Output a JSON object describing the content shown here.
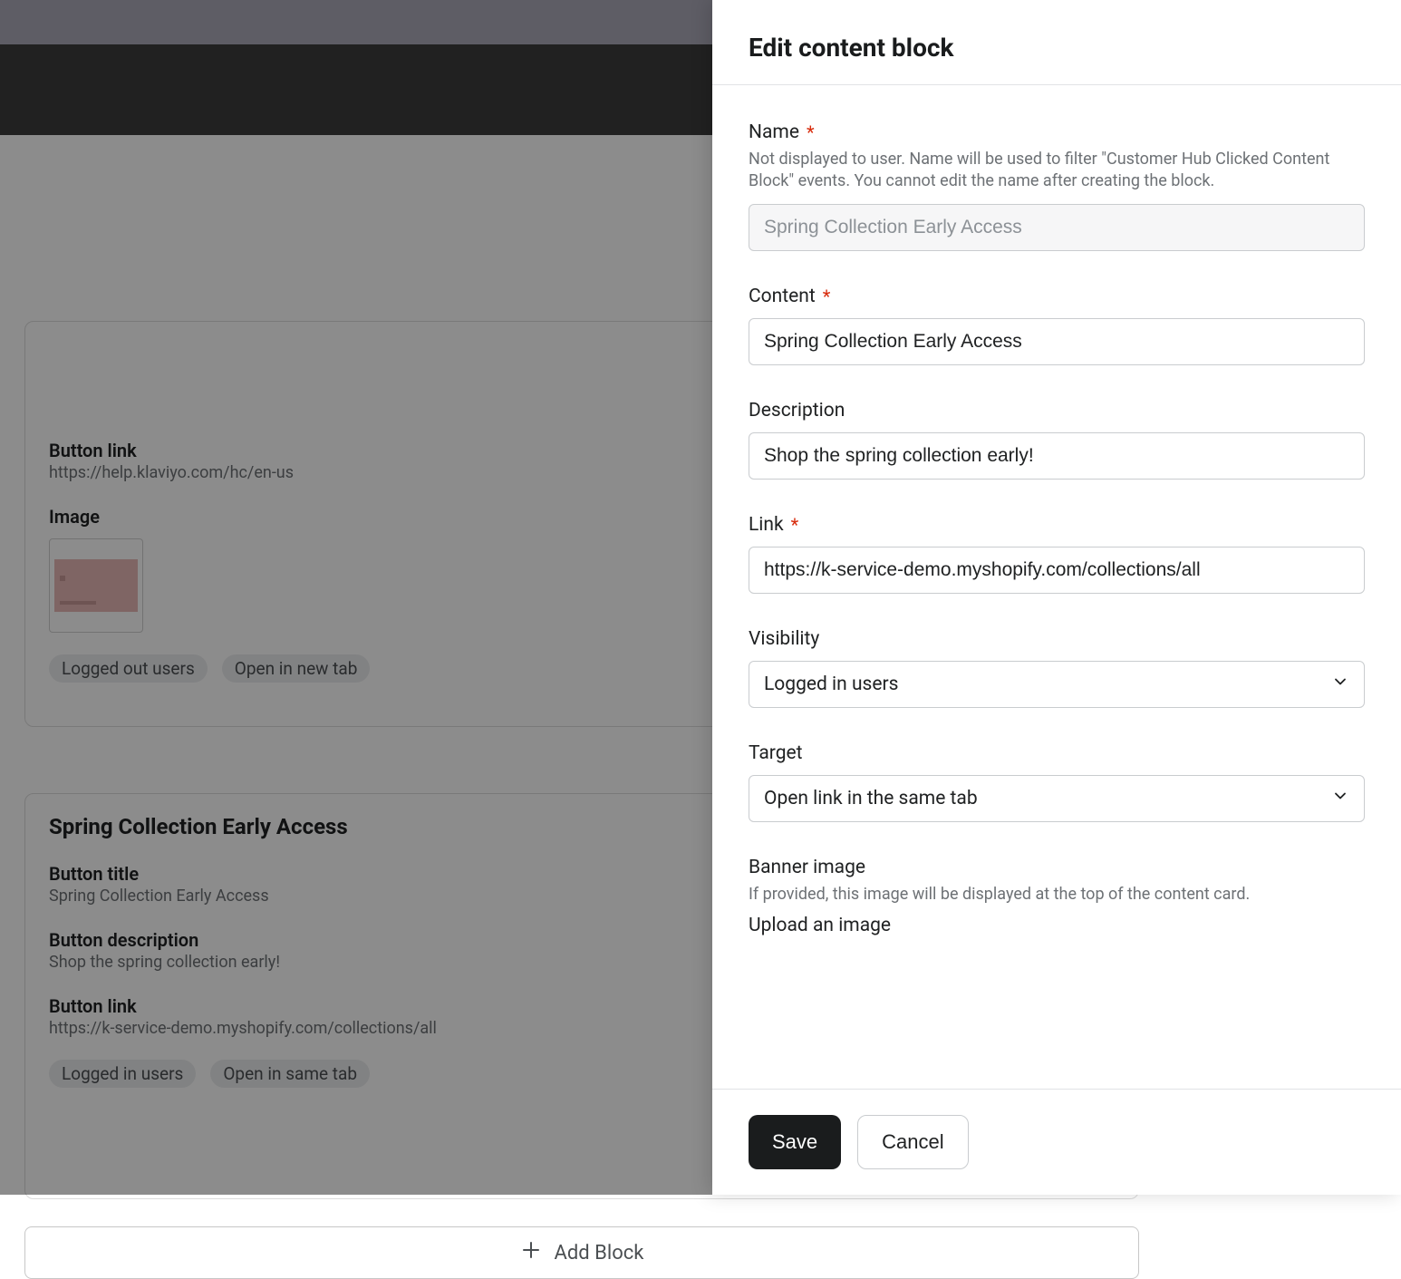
{
  "background": {
    "card1": {
      "button_link_h": "Button link",
      "button_link_v": "https://help.klaviyo.com/hc/en-us",
      "image_h": "Image",
      "tags": [
        "Logged out users",
        "Open in new tab"
      ]
    },
    "card2": {
      "title": "Spring Collection Early Access",
      "button_title_h": "Button title",
      "button_title_v": "Spring Collection Early Access",
      "button_desc_h": "Button description",
      "button_desc_v": "Shop the spring collection early!",
      "button_link_h": "Button link",
      "button_link_v": "https://k-service-demo.myshopify.com/collections/all",
      "tags": [
        "Logged in users",
        "Open in same tab"
      ]
    },
    "add_block": "Add Block"
  },
  "panel": {
    "title": "Edit content block",
    "fields": {
      "name": {
        "label": "Name",
        "help": "Not displayed to user. Name will be used to filter \"Customer Hub Clicked Content Block\" events. You cannot edit the name after creating the block.",
        "value": "Spring Collection Early Access"
      },
      "content": {
        "label": "Content",
        "value": "Spring Collection Early Access"
      },
      "description": {
        "label": "Description",
        "value": "Shop the spring collection early!"
      },
      "link": {
        "label": "Link",
        "value": "https://k-service-demo.myshopify.com/collections/all"
      },
      "visibility": {
        "label": "Visibility",
        "value": "Logged in users"
      },
      "target": {
        "label": "Target",
        "value": "Open link in the same tab"
      },
      "banner": {
        "label": "Banner image",
        "help": "If provided, this image will be displayed at the top of the content card.",
        "upload": "Upload an image"
      }
    },
    "buttons": {
      "save": "Save",
      "cancel": "Cancel"
    }
  }
}
